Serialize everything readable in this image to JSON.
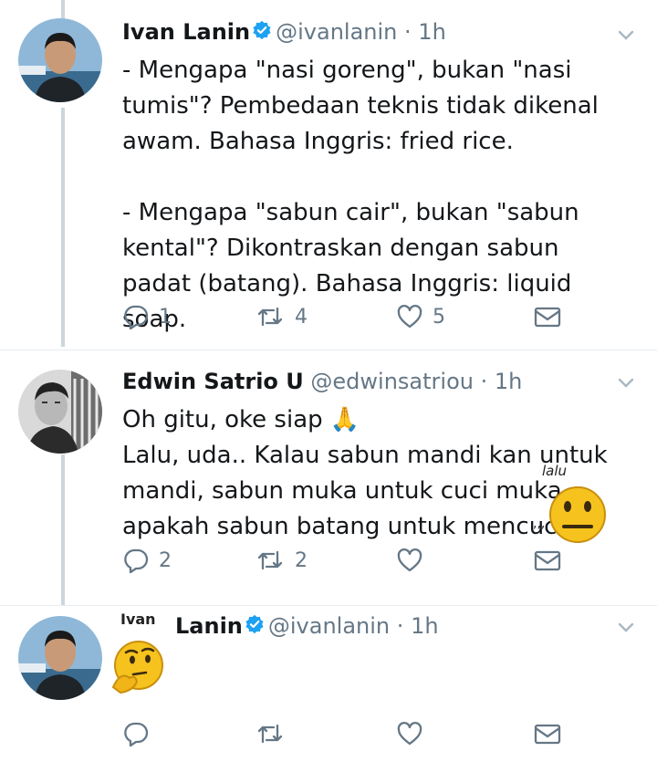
{
  "tweets": [
    {
      "name": "Ivan Lanin",
      "handle": "@ivanlanin",
      "dot": "·",
      "time": "1h",
      "verified": true,
      "text": "- Mengapa \"nasi goreng\", bukan \"nasi tumis\"? Pembedaan teknis tidak dikenal awam. Bahasa Inggris: fried rice.\n\n- Mengapa \"sabun cair\", bukan \"sabun kental\"? Dikontraskan dengan sabun padat (batang). Bahasa Inggris: liquid soap.",
      "replies": "1",
      "retweets": "4",
      "likes": "5"
    },
    {
      "name": "Edwin Satrio U",
      "handle": "@edwinsatriou",
      "dot": "·",
      "time": "1h",
      "verified": false,
      "text": "Oh gitu, oke siap 🙏\nLalu, uda.. Kalau sabun mandi kan untuk mandi, sabun muka untuk cuci muka,\napakah sabun batang untuk mencuci",
      "scribble_lalu": "lalu",
      "replies": "2",
      "retweets": "2",
      "likes": ""
    },
    {
      "name": "Lanin",
      "name_scribble": "Ivan",
      "handle": "@ivanlanin",
      "dot": "·",
      "time": "1h",
      "verified": true,
      "text": "",
      "replies": "",
      "retweets": "",
      "likes": ""
    }
  ],
  "icons": [
    "reply-icon",
    "retweet-icon",
    "like-icon",
    "direct-message-icon",
    "caret-down-icon",
    "verified-badge-icon"
  ],
  "colors": {
    "icon_gray": "#657786",
    "verified_blue": "#1da1f2",
    "divider": "#e6ecf0"
  }
}
